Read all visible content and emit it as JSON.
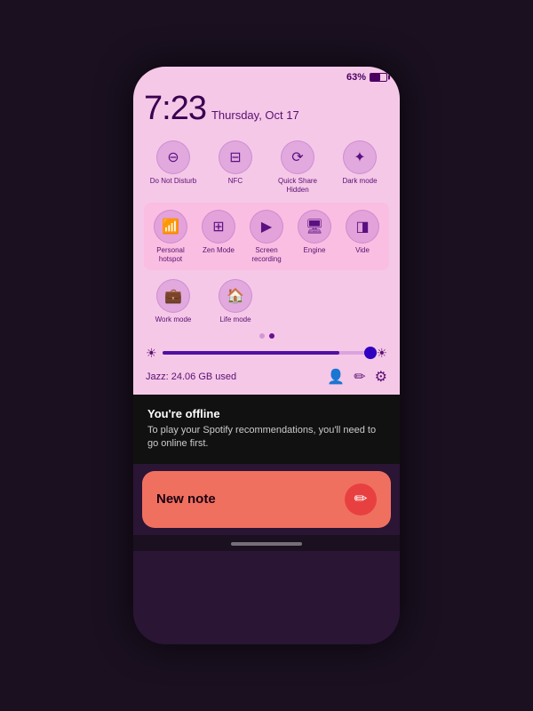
{
  "status_bar": {
    "battery_percent": "63%"
  },
  "time": {
    "time": "7:23",
    "date": "Thursday, Oct 17"
  },
  "quick_toggles_row1": [
    {
      "id": "do-not-disturb",
      "icon": "⊖",
      "label": "Do Not Disturb",
      "active": false
    },
    {
      "id": "nfc",
      "icon": "🪪",
      "label": "NFC",
      "active": false
    },
    {
      "id": "quick-share",
      "icon": "↻",
      "label": "Quick Share\nHidden",
      "active": false
    },
    {
      "id": "dark-mode",
      "icon": "☀",
      "label": "Dark mode",
      "active": false
    }
  ],
  "quick_toggles_row2": [
    {
      "id": "hotspot",
      "icon": "📡",
      "label": "Personal hotspot",
      "active": false
    },
    {
      "id": "zen-mode",
      "icon": "⊟",
      "label": "Zen Mode",
      "active": false
    },
    {
      "id": "screen-rec",
      "icon": "▶",
      "label": "Screen recording",
      "active": false
    },
    {
      "id": "engine",
      "icon": "🖥",
      "label": "Engine",
      "active": false
    },
    {
      "id": "video",
      "icon": "◨",
      "label": "Vide",
      "active": false
    }
  ],
  "quick_toggles_row3": [
    {
      "id": "work-mode",
      "icon": "💼",
      "label": "Work mode",
      "active": false
    },
    {
      "id": "life-mode",
      "icon": "🏠",
      "label": "Life mode",
      "active": false
    }
  ],
  "pagination": {
    "current": 1,
    "total": 2
  },
  "brightness": {
    "value": 85,
    "min_icon": "☀",
    "max_icon": "☀"
  },
  "footer": {
    "storage": "Jazz: 24.06 GB used",
    "icons": [
      "👤",
      "✏",
      "⚙"
    ]
  },
  "spotify_notification": {
    "title": "You're offline",
    "body": "To play your Spotify recommendations, you'll need to go online first."
  },
  "new_note": {
    "label": "New note",
    "icon": "✏"
  }
}
